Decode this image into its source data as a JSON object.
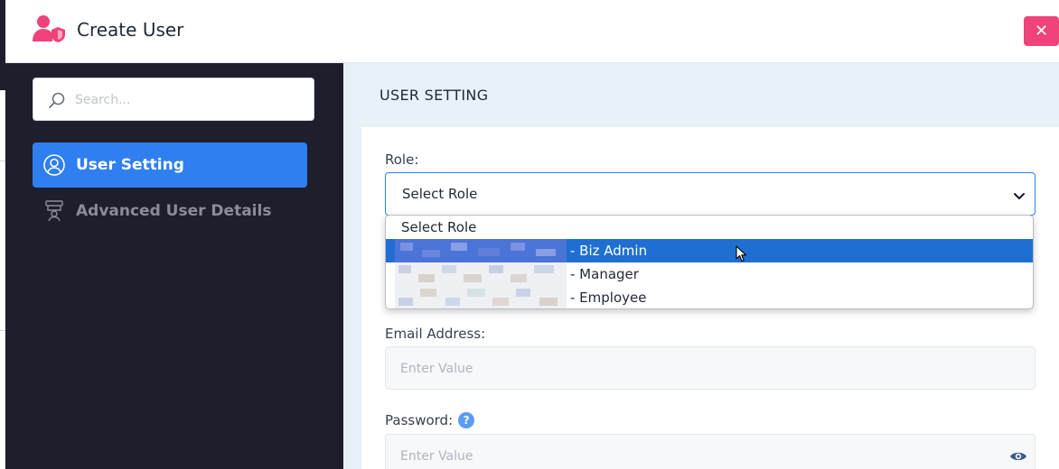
{
  "header": {
    "title": "Create User",
    "close_label": "✕"
  },
  "sidebar": {
    "search_placeholder": "Search...",
    "items": [
      {
        "label": "User Setting",
        "active": true
      },
      {
        "label": "Advanced User Details",
        "active": false
      }
    ]
  },
  "main": {
    "section_title": "USER SETTING",
    "role": {
      "label": "Role:",
      "selected": "Select Role",
      "options": [
        {
          "label": "Select Role"
        },
        {
          "label": "- Biz Admin",
          "redacted": true,
          "highlighted": true
        },
        {
          "label": "- Manager",
          "redacted": true
        },
        {
          "label": "- Employee",
          "redacted": true
        }
      ]
    },
    "email": {
      "label": "Email Address:",
      "placeholder": "Enter Value"
    },
    "password": {
      "label": "Password:",
      "help_icon": "?",
      "placeholder": "Enter Value"
    }
  },
  "colors": {
    "sidebar_bg": "#1e1e2d",
    "accent": "#2f7ff0",
    "close_button": "#f0437a",
    "content_bg": "#e8f1f8"
  }
}
